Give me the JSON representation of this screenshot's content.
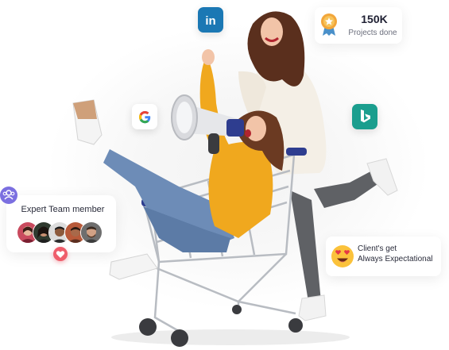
{
  "stats": {
    "value": "150K",
    "label": "Projects done",
    "icon": "award-ribbon-icon"
  },
  "team": {
    "title": "Expert Team member",
    "member_count": 5,
    "icons": [
      "team-icon",
      "heart-icon"
    ]
  },
  "client": {
    "line1": "Client's get",
    "line2": "Always Expectational",
    "icon": "heart-eyes-emoji-icon"
  },
  "social_icons": [
    "linkedin-icon",
    "google-icon",
    "bing-icon"
  ],
  "colors": {
    "linkedin": "#1b78b4",
    "bing": "#1a9e8e",
    "team_badge": "#7b6fe0",
    "heart": "#ef5d6b",
    "sweater_yellow": "#f0a81e",
    "sweater_cream": "#f4efe6"
  }
}
